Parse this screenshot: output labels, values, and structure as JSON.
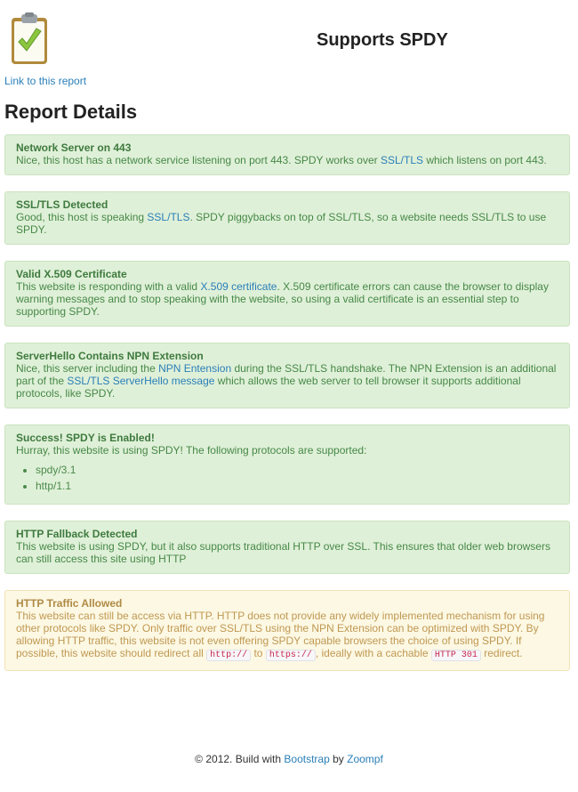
{
  "header": {
    "title": "Supports SPDY",
    "logo_icon": "clipboard-check-icon",
    "report_link": "Link to this report"
  },
  "section_title": "Report Details",
  "alerts": [
    {
      "title": "Network Server on 443",
      "text1": "Nice, this host has a network service listening on port 443. SPDY works over ",
      "link1": "SSL/TLS",
      "text2": " which listens on port 443."
    },
    {
      "title": "SSL/TLS Detected",
      "text1": "Good, this host is speaking ",
      "link1": "SSL/TLS",
      "text2": ". SPDY piggybacks on top of SSL/TLS, so a website needs SSL/TLS to use SPDY."
    },
    {
      "title": "Valid X.509 Certificate",
      "text1": "This website is responding with a valid ",
      "link1": "X.509 certificate",
      "text2": ". X.509 certificate errors can cause the browser to display warning messages and to stop speaking with the website, so using a valid certificate is an essential step to supporting SPDY."
    },
    {
      "title": "ServerHello Contains NPN Extension",
      "text1": "Nice, this server including the ",
      "link1": "NPN Entension",
      "text2": " during the SSL/TLS handshake. The NPN Extension is an additional part of the ",
      "link2": "SSL/TLS ServerHello message",
      "text3": " which allows the web server to tell browser it supports additional protocols, like SPDY."
    },
    {
      "title": "Success! SPDY is Enabled!",
      "text1": "Hurray, this website is using SPDY! The following protocols are supported:",
      "protocols": [
        "spdy/3.1",
        "http/1.1"
      ]
    },
    {
      "title": "HTTP Fallback Detected",
      "text1": "This website is using SPDY, but it also supports traditional HTTP over SSL. This ensures that older web browsers can still access this site using HTTP"
    },
    {
      "title": "HTTP Traffic Allowed",
      "text1": "This website can still be access via HTTP. HTTP does not provide any widely implemented mechanism for using other protocols like SPDY. Only traffic over SSL/TLS using the NPN Extension can be optimized with SPDY. By allowing HTTP traffic, this website is not even offering SPDY capable browsers the choice of using SPDY. If possible, this website should redirect all ",
      "code1": "http://",
      "text2": " to ",
      "code2": "https://",
      "text3": ", ideally with a cachable ",
      "code3": "HTTP 301",
      "text4": " redirect."
    }
  ],
  "footer": {
    "prefix": "© 2012. Build with ",
    "link1": "Bootstrap",
    "middle": " by ",
    "link2": "Zoompf"
  },
  "colors": {
    "success_bg": "#dff0d8",
    "success_text": "#468847",
    "warning_bg": "#fcf8e3",
    "warning_text": "#c09853",
    "link": "#2a7fb8"
  }
}
